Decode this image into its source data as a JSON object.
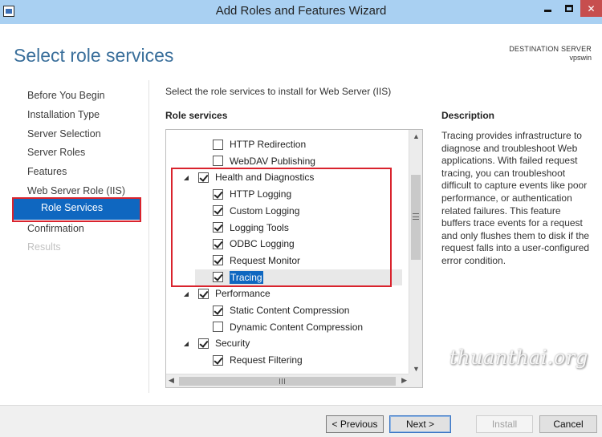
{
  "window": {
    "title": "Add Roles and Features Wizard",
    "close_glyph": "✕",
    "icon": "server-manager-icon"
  },
  "page": {
    "title": "Select role services",
    "destination_label": "DESTINATION SERVER",
    "destination_name": "vpswin"
  },
  "nav": {
    "items": [
      {
        "label": "Before You Begin",
        "state": "normal"
      },
      {
        "label": "Installation Type",
        "state": "normal"
      },
      {
        "label": "Server Selection",
        "state": "normal"
      },
      {
        "label": "Server Roles",
        "state": "normal"
      },
      {
        "label": "Features",
        "state": "normal"
      },
      {
        "label": "Web Server Role (IIS)",
        "state": "normal"
      },
      {
        "label": "Role Services",
        "state": "active"
      },
      {
        "label": "Confirmation",
        "state": "normal"
      },
      {
        "label": "Results",
        "state": "disabled"
      }
    ]
  },
  "content": {
    "instruction": "Select the role services to install for Web Server (IIS)",
    "role_services_heading": "Role services",
    "tree": [
      {
        "label": "HTTP Redirection",
        "checked": false,
        "expander": "",
        "level": 2
      },
      {
        "label": "WebDAV Publishing",
        "checked": false,
        "expander": "",
        "level": 2
      },
      {
        "label": "Health and Diagnostics",
        "checked": true,
        "expander": "◢",
        "level": 1
      },
      {
        "label": "HTTP Logging",
        "checked": true,
        "expander": "",
        "level": 2
      },
      {
        "label": "Custom Logging",
        "checked": true,
        "expander": "",
        "level": 2
      },
      {
        "label": "Logging Tools",
        "checked": true,
        "expander": "",
        "level": 2
      },
      {
        "label": "ODBC Logging",
        "checked": true,
        "expander": "",
        "level": 2
      },
      {
        "label": "Request Monitor",
        "checked": true,
        "expander": "",
        "level": 2
      },
      {
        "label": "Tracing",
        "checked": true,
        "expander": "",
        "level": 2,
        "selected": true
      },
      {
        "label": "Performance",
        "checked": true,
        "expander": "◢",
        "level": 1
      },
      {
        "label": "Static Content Compression",
        "checked": true,
        "expander": "",
        "level": 2
      },
      {
        "label": "Dynamic Content Compression",
        "checked": false,
        "expander": "",
        "level": 2
      },
      {
        "label": "Security",
        "checked": true,
        "expander": "◢",
        "level": 1
      },
      {
        "label": "Request Filtering",
        "checked": true,
        "expander": "",
        "level": 2
      }
    ],
    "scroll_up": "▲",
    "scroll_down": "▼",
    "scroll_left": "◀",
    "scroll_right": "▶"
  },
  "description": {
    "heading": "Description",
    "text": "Tracing provides infrastructure to diagnose and troubleshoot Web applications. With failed request tracing, you can troubleshoot difficult to capture events like poor performance, or authentication related failures. This feature buffers trace events for a request and only flushes them to disk if the request falls into a user-configured error condition."
  },
  "watermark": "thuanthai.org",
  "buttons": {
    "previous": "< Previous",
    "next": "Next >",
    "install": "Install",
    "cancel": "Cancel"
  },
  "colors": {
    "titlebar": "#a9d0f2",
    "accent": "#0f67c0",
    "highlight_border": "#d9232d",
    "close_button": "#c74e4e"
  }
}
